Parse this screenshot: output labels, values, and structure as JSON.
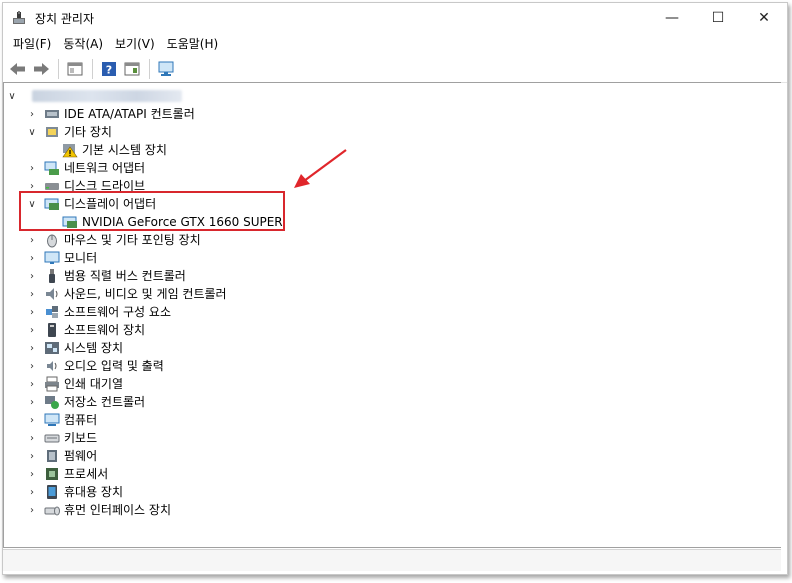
{
  "window": {
    "title": "장치 관리자",
    "controls": {
      "minimize": "—",
      "maximize": "☐",
      "close": "✕"
    }
  },
  "menu": [
    {
      "label": "파일(F)"
    },
    {
      "label": "동작(A)"
    },
    {
      "label": "보기(V)"
    },
    {
      "label": "도움말(H)"
    }
  ],
  "toolbar": [
    "back-icon",
    "forward-icon",
    "properties-icon",
    "help-icon",
    "action-icon",
    "monitor-icon"
  ],
  "tree": {
    "root_expander": "∨",
    "items": [
      {
        "label": "IDE ATA/ATAPI 컨트롤러",
        "icon": "ide-controller-icon",
        "expander": "›"
      },
      {
        "label": "기타 장치",
        "icon": "other-devices-icon",
        "expander": "∨"
      },
      {
        "label": "기본 시스템 장치",
        "icon": "warning-device-icon",
        "child": true
      },
      {
        "label": "네트워크 어댑터",
        "icon": "network-adapter-icon",
        "expander": "›"
      },
      {
        "label": "디스크 드라이브",
        "icon": "disk-drive-icon",
        "expander": "›"
      },
      {
        "label": "디스플레이 어댑터",
        "icon": "display-adapter-icon",
        "expander": "∨"
      },
      {
        "label": "NVIDIA GeForce GTX 1660 SUPER",
        "icon": "gpu-icon",
        "child": true
      },
      {
        "label": "마우스 및 기타 포인팅 장치",
        "icon": "mouse-icon",
        "expander": "›"
      },
      {
        "label": "모니터",
        "icon": "monitor-icon",
        "expander": "›"
      },
      {
        "label": "범용 직렬 버스 컨트롤러",
        "icon": "usb-icon",
        "expander": "›"
      },
      {
        "label": "사운드, 비디오 및 게임 컨트롤러",
        "icon": "sound-icon",
        "expander": "›"
      },
      {
        "label": "소프트웨어 구성 요소",
        "icon": "software-component-icon",
        "expander": "›"
      },
      {
        "label": "소프트웨어 장치",
        "icon": "software-device-icon",
        "expander": "›"
      },
      {
        "label": "시스템 장치",
        "icon": "system-device-icon",
        "expander": "›"
      },
      {
        "label": "오디오 입력 및 출력",
        "icon": "audio-io-icon",
        "expander": "›"
      },
      {
        "label": "인쇄 대기열",
        "icon": "printer-icon",
        "expander": "›"
      },
      {
        "label": "저장소 컨트롤러",
        "icon": "storage-controller-icon",
        "expander": "›"
      },
      {
        "label": "컴퓨터",
        "icon": "computer-icon",
        "expander": "›"
      },
      {
        "label": "키보드",
        "icon": "keyboard-icon",
        "expander": "›"
      },
      {
        "label": "펌웨어",
        "icon": "firmware-icon",
        "expander": "›"
      },
      {
        "label": "프로세서",
        "icon": "processor-icon",
        "expander": "›"
      },
      {
        "label": "휴대용 장치",
        "icon": "portable-device-icon",
        "expander": "›"
      },
      {
        "label": "휴먼 인터페이스 장치",
        "icon": "hid-icon",
        "expander": "›"
      }
    ]
  },
  "colors": {
    "highlight": "#d8272d",
    "arrow": "#e0262b"
  }
}
